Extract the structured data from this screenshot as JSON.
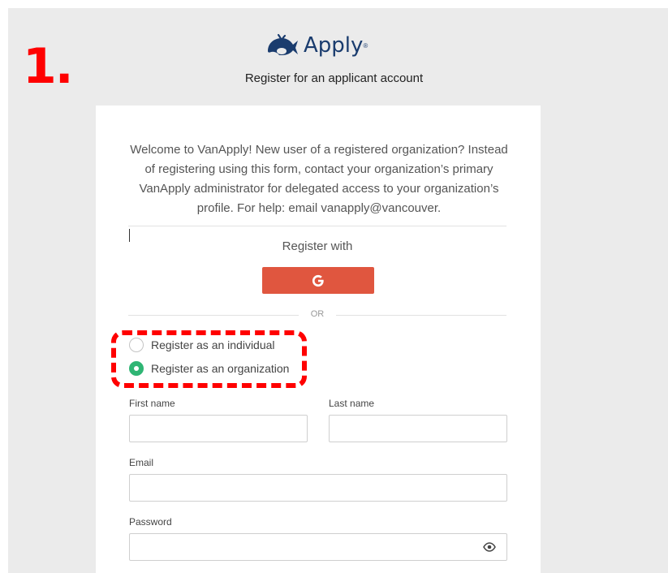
{
  "annotation": {
    "step_number": "1.",
    "highlight_color": "#ff0000"
  },
  "brand": {
    "logo_icon": "vanapply-whale-icon",
    "logo_text": "Apply",
    "logo_reg": "®",
    "color": "#1a3c6e"
  },
  "page": {
    "title": "Register for an applicant account"
  },
  "card": {
    "welcome_text": "Welcome to VanApply! New user of a registered organization? Instead of registering using this form, contact your organization’s primary VanApply administrator for delegated access to your organization’s profile. For help: email vanapply@vancouver.",
    "register_with": "Register with",
    "google_button": {
      "label": "G",
      "color": "#e0563f"
    },
    "or_separator": "OR"
  },
  "account_type": {
    "options": [
      {
        "label": "Register as an individual",
        "checked": false
      },
      {
        "label": "Register as an organization",
        "checked": true
      }
    ],
    "checked_color": "#2fb574"
  },
  "form": {
    "first_name": {
      "label": "First name",
      "value": "",
      "placeholder": ""
    },
    "last_name": {
      "label": "Last name",
      "value": "",
      "placeholder": ""
    },
    "email": {
      "label": "Email",
      "value": "",
      "placeholder": ""
    },
    "password": {
      "label": "Password",
      "value": "",
      "placeholder": "",
      "toggle_icon": "eye-icon"
    }
  }
}
